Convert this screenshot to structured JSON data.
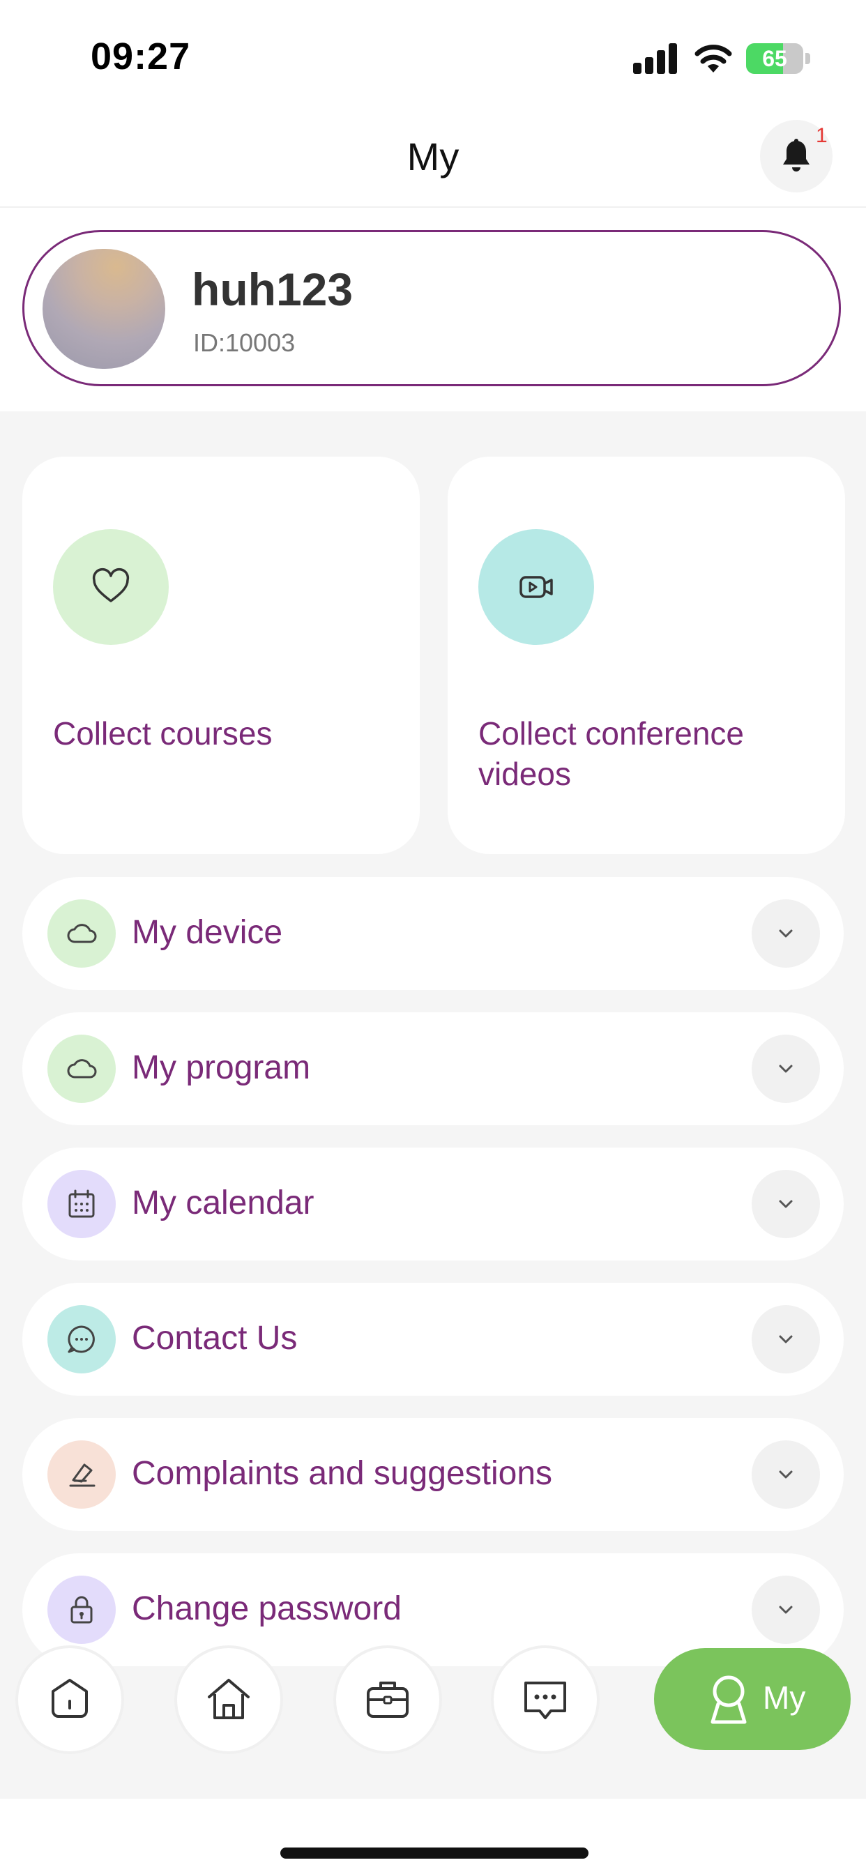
{
  "status_bar": {
    "time": "09:27",
    "battery": "65",
    "battery_level": 0.65
  },
  "header": {
    "title": "My",
    "notification_count": "1"
  },
  "profile": {
    "username": "huh123",
    "id": "ID:10003"
  },
  "favorites": [
    {
      "label": "Collect courses",
      "icon": "heart-icon",
      "color": "#d9f2d3"
    },
    {
      "label": "Collect conference videos",
      "icon": "video-icon",
      "color": "#b6e9e6"
    }
  ],
  "menu": [
    {
      "label": "My device",
      "icon": "cloud-icon",
      "color": "#d9f2d3"
    },
    {
      "label": "My program",
      "icon": "cloud-icon",
      "color": "#d9f2d3"
    },
    {
      "label": "My calendar",
      "icon": "calendar-icon",
      "color": "#e3dcfb"
    },
    {
      "label": "Contact Us",
      "icon": "chat-icon",
      "color": "#bdebe6"
    },
    {
      "label": "Complaints and suggestions",
      "icon": "edit-icon",
      "color": "#f8e1d7"
    },
    {
      "label": "Change password",
      "icon": "lock-icon",
      "color": "#e3dcfb"
    }
  ],
  "nav": {
    "items": [
      "shield-home-icon",
      "home-icon",
      "briefcase-icon",
      "message-icon"
    ],
    "active_label": "My",
    "active_color": "#7bc45c"
  },
  "colors": {
    "accent": "#7a2a78",
    "background": "#f5f5f5"
  }
}
